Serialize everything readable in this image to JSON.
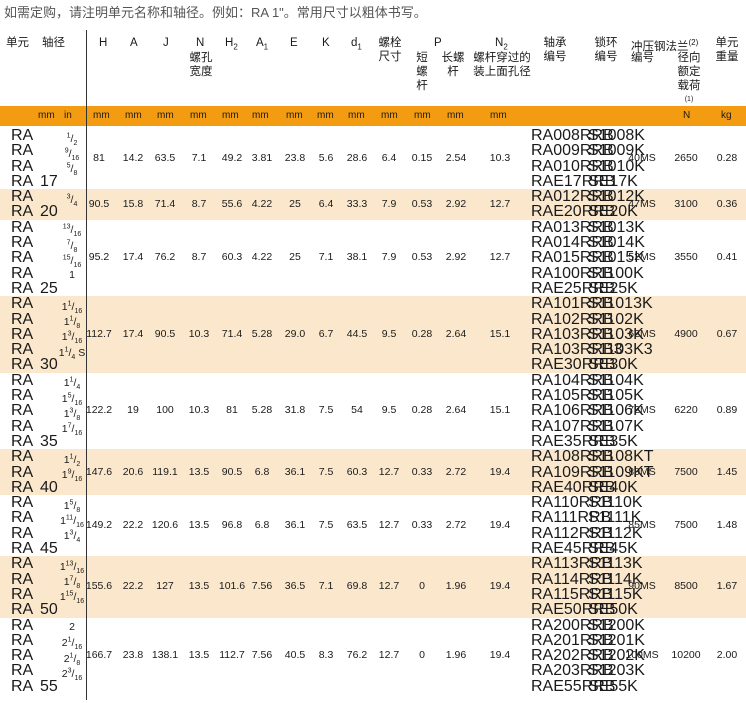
{
  "note": "如需定购，请注明单元名称和轴径。例如：RA 1\"。常用尺寸以粗体书写。",
  "headers": {
    "unit": "单元",
    "shaft": "轴径",
    "H": "H",
    "A": "A",
    "J": "J",
    "N": "N",
    "N_sub": "螺孔宽度",
    "H2": "H",
    "A1": "A",
    "E": "E",
    "K": "K",
    "d1": "d",
    "bolt_size": "螺栓尺寸",
    "P": "P",
    "P_short": "短螺杆",
    "P_long": "长螺杆",
    "N2": "N",
    "N2_sub": "螺杆穿过的装上面孔径",
    "bearing_no": "轴承编号",
    "collar_no": "锁环编号",
    "flange": "冲压钢法兰",
    "flange_sup": "(2)",
    "flange_no": "编号",
    "radial_load": "径向额定载荷",
    "radial_sup": "(1)",
    "weight": "单元重量"
  },
  "units": {
    "shaft_mm": "mm",
    "shaft_in": "in",
    "H": "mm",
    "A": "mm",
    "J": "mm",
    "N": "mm",
    "H2": "mm",
    "A1": "mm",
    "E": "mm",
    "K": "mm",
    "d1": "mm",
    "bolt": "mm",
    "P_short": "mm",
    "P_long": "mm",
    "N2": "mm",
    "load": "N",
    "weight": "kg"
  },
  "groups": [
    {
      "shade": false,
      "rows": [
        {
          "unit": "RA",
          "mm": "",
          "in": "1/2",
          "bearing": "RA008RRB",
          "collar": "S1008K"
        },
        {
          "unit": "RA",
          "mm": "",
          "in": "9/16",
          "bearing": "RA009RRB",
          "collar": "S1009K"
        },
        {
          "unit": "RA",
          "mm": "",
          "in": "5/8",
          "bearing": "RA010RRB",
          "collar": "S1010K"
        },
        {
          "unit": "RA",
          "mm": "17",
          "in": "",
          "bearing": "RAE17RRB",
          "collar": "SE17K"
        }
      ],
      "H": "81",
      "A": "14.2",
      "J": "63.5",
      "N": "7.1",
      "H2": "49.2",
      "A1": "3.81",
      "E": "23.8",
      "K": "5.6",
      "d1": "28.6",
      "bolt": "6.4",
      "Ps": "0.15",
      "Pl": "2.54",
      "N2": "10.3",
      "flange": "40MS",
      "load": "2650",
      "weight": "0.28"
    },
    {
      "shade": true,
      "rows": [
        {
          "unit": "RA",
          "mm": "",
          "in": "3/4",
          "bearing": "RA012RRB",
          "collar": "S1012K"
        },
        {
          "unit": "RA",
          "mm": "20",
          "in": "",
          "bearing": "RAE20RRB",
          "collar": "SE20K"
        }
      ],
      "H": "90.5",
      "A": "15.8",
      "J": "71.4",
      "N": "8.7",
      "H2": "55.6",
      "A1": "4.22",
      "E": "25",
      "K": "6.4",
      "d1": "33.3",
      "bolt": "7.9",
      "Ps": "0.53",
      "Pl": "2.92",
      "N2": "12.7",
      "flange": "47MS",
      "load": "3100",
      "weight": "0.36"
    },
    {
      "shade": false,
      "rows": [
        {
          "unit": "RA",
          "mm": "",
          "in": "13/16",
          "bearing": "RA013RRB",
          "collar": "S1013K"
        },
        {
          "unit": "RA",
          "mm": "",
          "in": "7/8",
          "bearing": "RA014RRB",
          "collar": "S1014K"
        },
        {
          "unit": "RA",
          "mm": "",
          "in": "15/16",
          "bearing": "RA015RRB",
          "collar": "S1015K"
        },
        {
          "unit": "RA",
          "mm": "",
          "in": "1",
          "bearing": "RA100RRB",
          "collar": "S1100K"
        },
        {
          "unit": "RA",
          "mm": "25",
          "in": "",
          "bearing": "RAE25RRB",
          "collar": "SE25K"
        }
      ],
      "H": "95.2",
      "A": "17.4",
      "J": "76.2",
      "N": "8.7",
      "H2": "60.3",
      "A1": "4.22",
      "E": "25",
      "K": "7.1",
      "d1": "38.1",
      "bolt": "7.9",
      "Ps": "0.53",
      "Pl": "2.92",
      "N2": "12.7",
      "flange": "52MS",
      "load": "3550",
      "weight": "0.41"
    },
    {
      "shade": true,
      "rows": [
        {
          "unit": "RA",
          "mm": "",
          "in": "1 1/16",
          "bearing": "RA101RRB",
          "collar": "S11013K"
        },
        {
          "unit": "RA",
          "mm": "",
          "in": "1 1/8",
          "bearing": "RA102RRB",
          "collar": "S1102K"
        },
        {
          "unit": "RA",
          "mm": "",
          "in": "1 3/16",
          "bearing": "RA103RRB",
          "collar": "S1103K"
        },
        {
          "unit": "RA",
          "mm": "",
          "in": "1 1/4 S",
          "bearing": "RA103RRB3",
          "collar": "S1103K3"
        },
        {
          "unit": "RA",
          "mm": "30",
          "in": "",
          "bearing": "RAE30RRB",
          "collar": "SE30K"
        }
      ],
      "H": "112.7",
      "A": "17.4",
      "J": "90.5",
      "N": "10.3",
      "H2": "71.4",
      "A1": "5.28",
      "E": "29.0",
      "K": "6.7",
      "d1": "44.5",
      "bolt": "9.5",
      "Ps": "0.28",
      "Pl": "2.64",
      "N2": "15.1",
      "flange": "62MS",
      "load": "4900",
      "weight": "0.67"
    },
    {
      "shade": false,
      "rows": [
        {
          "unit": "RA",
          "mm": "",
          "in": "1 1/4",
          "bearing": "RA104RRB",
          "collar": "S1104K"
        },
        {
          "unit": "RA",
          "mm": "",
          "in": "1 5/16",
          "bearing": "RA105RRB",
          "collar": "S1105K"
        },
        {
          "unit": "RA",
          "mm": "",
          "in": "1 3/8",
          "bearing": "RA106RRB",
          "collar": "S1106K"
        },
        {
          "unit": "RA",
          "mm": "",
          "in": "1 7/16",
          "bearing": "RA107RRB",
          "collar": "S1107K"
        },
        {
          "unit": "RA",
          "mm": "35",
          "in": "",
          "bearing": "RAE35RRB",
          "collar": "SE35K"
        }
      ],
      "H": "122.2",
      "A": "19",
      "J": "100",
      "N": "10.3",
      "H2": "81",
      "A1": "5.28",
      "E": "31.8",
      "K": "7.5",
      "d1": "54",
      "bolt": "9.5",
      "Ps": "0.28",
      "Pl": "2.64",
      "N2": "15.1",
      "flange": "72MS",
      "load": "6220",
      "weight": "0.89"
    },
    {
      "shade": true,
      "rows": [
        {
          "unit": "RA",
          "mm": "",
          "in": "1 1/2",
          "bearing": "RA108RRB",
          "collar": "S1108KT"
        },
        {
          "unit": "RA",
          "mm": "",
          "in": "1 9/16",
          "bearing": "RA109RRB",
          "collar": "S1109KT"
        },
        {
          "unit": "RA",
          "mm": "40",
          "in": "",
          "bearing": "RAE40RRB",
          "collar": "SE40K"
        }
      ],
      "H": "147.6",
      "A": "20.6",
      "J": "119.1",
      "N": "13.5",
      "H2": "90.5",
      "A1": "6.8",
      "E": "36.1",
      "K": "7.5",
      "d1": "60.3",
      "bolt": "12.7",
      "Ps": "0.33",
      "Pl": "2.72",
      "N2": "19.4",
      "flange": "80MS",
      "load": "7500",
      "weight": "1.45"
    },
    {
      "shade": false,
      "rows": [
        {
          "unit": "RA",
          "mm": "",
          "in": "1 5/8",
          "bearing": "RA110RRB",
          "collar": "S1110K"
        },
        {
          "unit": "RA",
          "mm": "",
          "in": "1 11/16",
          "bearing": "RA111RRB",
          "collar": "S1111K"
        },
        {
          "unit": "RA",
          "mm": "",
          "in": "1 3/4",
          "bearing": "RA112RRB",
          "collar": "S1112K"
        },
        {
          "unit": "RA",
          "mm": "45",
          "in": "",
          "bearing": "RAE45RRB",
          "collar": "SE45K"
        }
      ],
      "H": "149.2",
      "A": "22.2",
      "J": "120.6",
      "N": "13.5",
      "H2": "96.8",
      "A1": "6.8",
      "E": "36.1",
      "K": "7.5",
      "d1": "63.5",
      "bolt": "12.7",
      "Ps": "0.33",
      "Pl": "2.72",
      "N2": "19.4",
      "flange": "85MS",
      "load": "7500",
      "weight": "1.48"
    },
    {
      "shade": true,
      "rows": [
        {
          "unit": "RA",
          "mm": "",
          "in": "1 13/16",
          "bearing": "RA113RRB",
          "collar": "S1113K"
        },
        {
          "unit": "RA",
          "mm": "",
          "in": "1 7/8",
          "bearing": "RA114RRB",
          "collar": "S1114K"
        },
        {
          "unit": "RA",
          "mm": "",
          "in": "1 15/16",
          "bearing": "RA115RRB",
          "collar": "S1115K"
        },
        {
          "unit": "RA",
          "mm": "50",
          "in": "",
          "bearing": "RAE50RRB",
          "collar": "SE50K"
        }
      ],
      "H": "155.6",
      "A": "22.2",
      "J": "127",
      "N": "13.5",
      "H2": "101.6",
      "A1": "7.56",
      "E": "36.5",
      "K": "7.1",
      "d1": "69.8",
      "bolt": "12.7",
      "Ps": "0",
      "Pl": "1.96",
      "N2": "19.4",
      "flange": "90MS",
      "load": "8500",
      "weight": "1.67"
    },
    {
      "shade": false,
      "rows": [
        {
          "unit": "RA",
          "mm": "",
          "in": "2",
          "bearing": "RA200RRB",
          "collar": "S1200K"
        },
        {
          "unit": "RA",
          "mm": "",
          "in": "2 1/16",
          "bearing": "RA201RRB",
          "collar": "S1201K"
        },
        {
          "unit": "RA",
          "mm": "",
          "in": "2 1/8",
          "bearing": "RA202RRB",
          "collar": "S1202K"
        },
        {
          "unit": "RA",
          "mm": "",
          "in": "2 3/16",
          "bearing": "RA203RRB",
          "collar": "S1203K"
        },
        {
          "unit": "RA",
          "mm": "55",
          "in": "",
          "bearing": "RAE55RRB",
          "collar": "SE55K"
        }
      ],
      "H": "166.7",
      "A": "23.8",
      "J": "138.1",
      "N": "13.5",
      "H2": "112.7",
      "A1": "7.56",
      "E": "40.5",
      "K": "8.3",
      "d1": "76.2",
      "bolt": "12.7",
      "Ps": "0",
      "Pl": "1.96",
      "N2": "19.4",
      "flange": "100MS",
      "load": "10200",
      "weight": "2.00"
    }
  ]
}
